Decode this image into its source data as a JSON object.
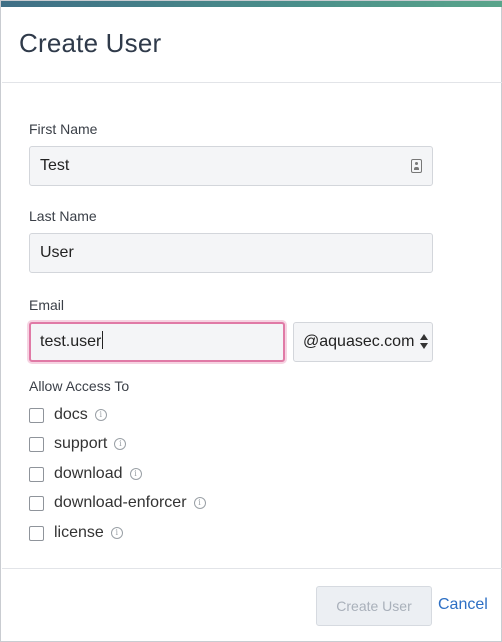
{
  "dialog": {
    "title": "Create User"
  },
  "form": {
    "first_name": {
      "label": "First Name",
      "value": "Test"
    },
    "last_name": {
      "label": "Last Name",
      "value": "User"
    },
    "email": {
      "label": "Email",
      "value": "test.user",
      "domain": "@aquasec.com"
    },
    "access": {
      "label": "Allow Access To",
      "items": [
        {
          "label": "docs",
          "checked": false
        },
        {
          "label": "support",
          "checked": false
        },
        {
          "label": "download",
          "checked": false
        },
        {
          "label": "download-enforcer",
          "checked": false
        },
        {
          "label": "license",
          "checked": false
        }
      ]
    }
  },
  "footer": {
    "create_label": "Create User",
    "cancel_label": "Cancel"
  },
  "colors": {
    "focus": "#e07aa6",
    "link": "#2d6fc4",
    "title": "#2f3a4a"
  }
}
